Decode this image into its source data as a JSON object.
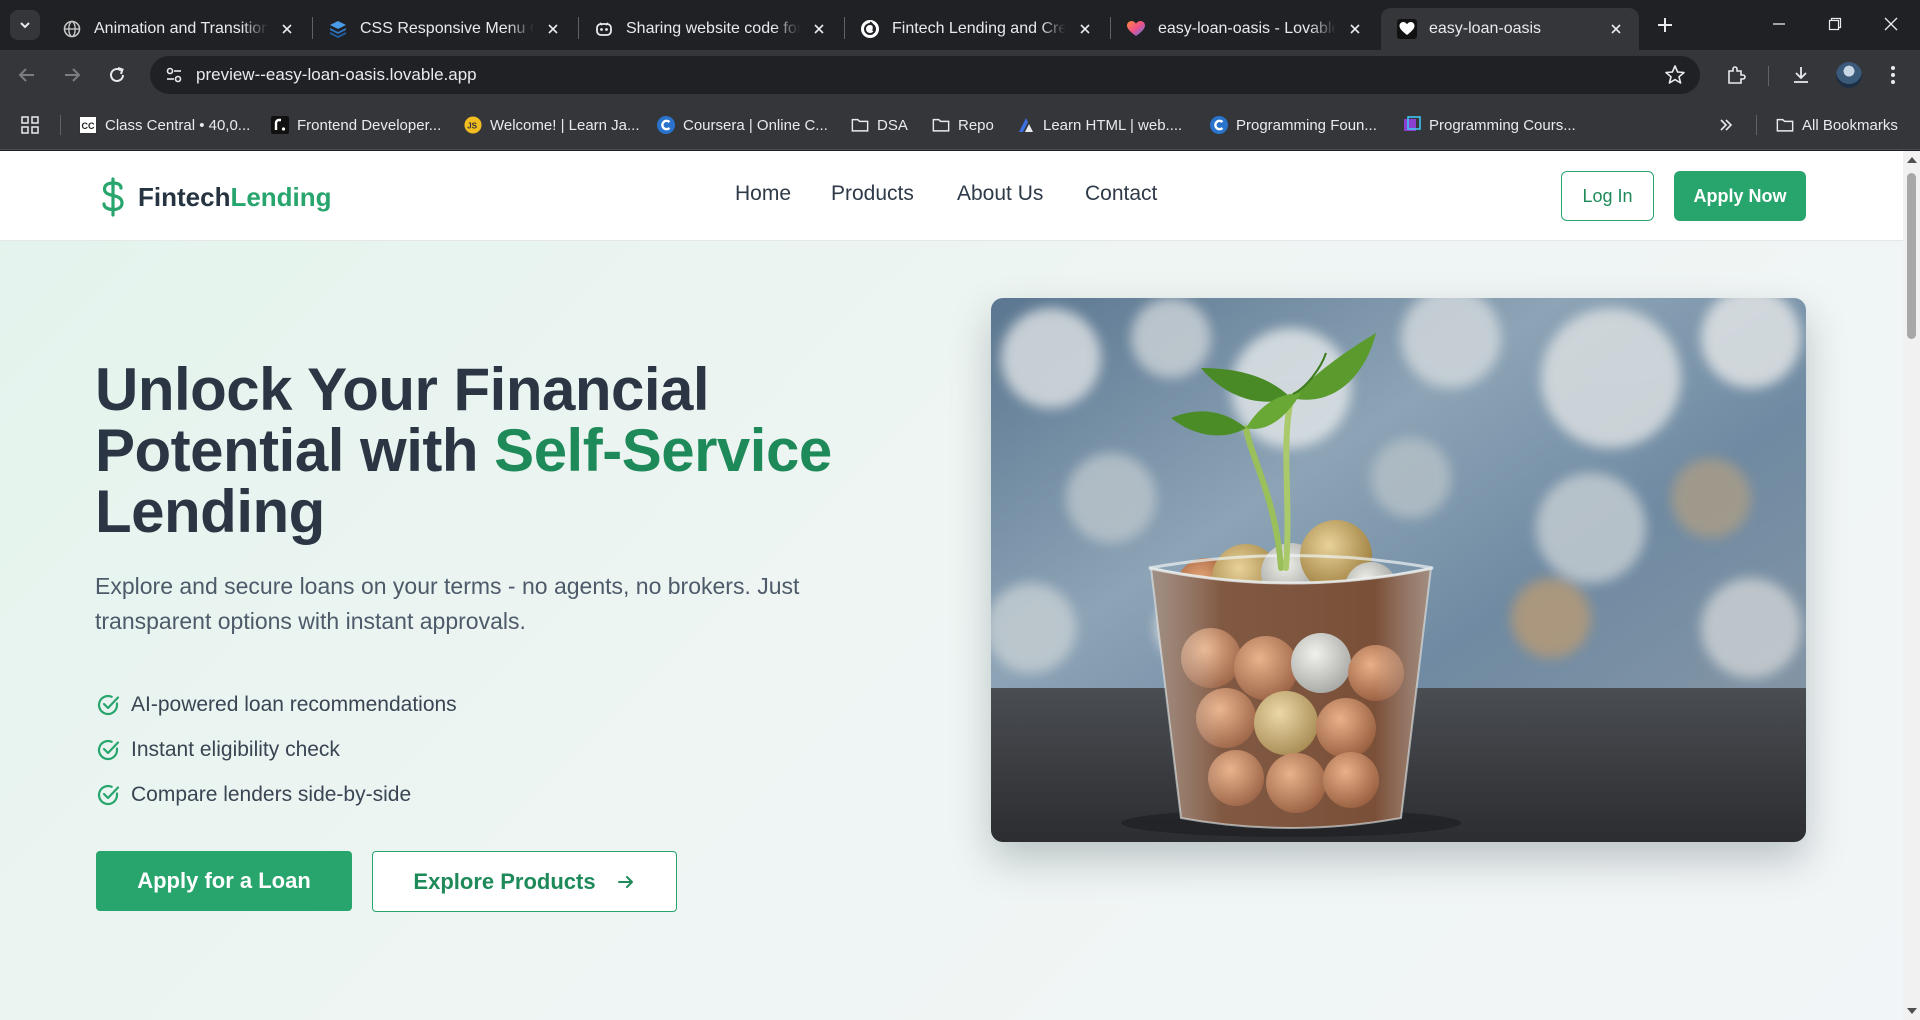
{
  "browser": {
    "tabs": [
      {
        "title": "Animation and Transitions",
        "icon": "globe-icon"
      },
      {
        "title": "CSS Responsive Menu Gen",
        "icon": "layers-icon"
      },
      {
        "title": "Sharing website code for a",
        "icon": "robot-icon"
      },
      {
        "title": "Fintech Lending and Credit",
        "icon": "chatgpt-icon"
      },
      {
        "title": "easy-loan-oasis - Lovable",
        "icon": "lovable-heart-icon"
      },
      {
        "title": "easy-loan-oasis",
        "icon": "white-heart-icon",
        "active": true
      }
    ],
    "url": "preview--easy-loan-oasis.lovable.app",
    "bookmarks": [
      {
        "label": "Class Central • 40,0...",
        "icon": "classcentral-icon"
      },
      {
        "label": "Frontend Developer...",
        "icon": "frontend-icon"
      },
      {
        "label": "Welcome! | Learn Ja...",
        "icon": "js-icon"
      },
      {
        "label": "Coursera | Online C...",
        "icon": "coursera-icon"
      },
      {
        "label": "DSA",
        "icon": "folder-icon"
      },
      {
        "label": "Repo",
        "icon": "folder-icon"
      },
      {
        "label": "Learn HTML  |  web....",
        "icon": "webdev-icon"
      },
      {
        "label": "Programming Foun...",
        "icon": "coursera-icon"
      },
      {
        "label": "Programming Cours...",
        "icon": "course-icon"
      }
    ],
    "all_bookmarks_label": "All Bookmarks"
  },
  "site": {
    "logo": {
      "part1": "Fintech",
      "part2": "Lending"
    },
    "nav": [
      "Home",
      "Products",
      "About Us",
      "Contact"
    ],
    "login_label": "Log In",
    "apply_now_label": "Apply Now"
  },
  "hero": {
    "title_line1": "Unlock Your Financial",
    "title_line2_prefix": "Potential with ",
    "title_accent": "Self-Service",
    "title_line3": "Lending",
    "subtitle": "Explore and secure loans on your terms - no agents, no brokers. Just transparent options with instant approvals.",
    "features": [
      "AI-powered loan recommendations",
      "Instant eligibility check",
      "Compare lenders side-by-side"
    ],
    "primary_cta": "Apply for a Loan",
    "secondary_cta": "Explore Products"
  },
  "colors": {
    "brand_green": "#27a56d",
    "dark_text": "#2b3543",
    "chrome_bg": "#202124"
  }
}
